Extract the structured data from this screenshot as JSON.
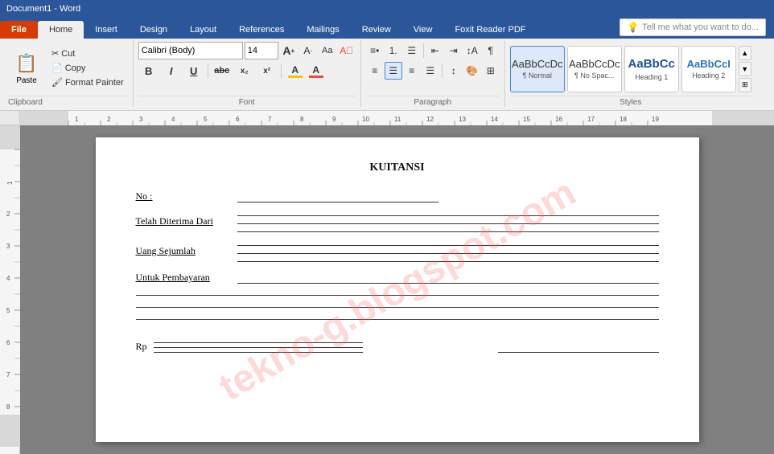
{
  "titlebar": {
    "title": "Document1 - Word"
  },
  "tabs": [
    {
      "id": "file",
      "label": "File",
      "type": "file"
    },
    {
      "id": "home",
      "label": "Home",
      "type": "active"
    },
    {
      "id": "insert",
      "label": "Insert",
      "type": "normal"
    },
    {
      "id": "design",
      "label": "Design",
      "type": "normal"
    },
    {
      "id": "layout",
      "label": "Layout",
      "type": "normal"
    },
    {
      "id": "references",
      "label": "References",
      "type": "normal"
    },
    {
      "id": "mailings",
      "label": "Mailings",
      "type": "normal"
    },
    {
      "id": "review",
      "label": "Review",
      "type": "normal"
    },
    {
      "id": "view",
      "label": "View",
      "type": "normal"
    },
    {
      "id": "foxit",
      "label": "Foxit Reader PDF",
      "type": "normal"
    }
  ],
  "toolbar": {
    "tell_me_placeholder": "Tell me what you want to do...",
    "clipboard": {
      "paste_label": "Paste",
      "cut_label": "Cut",
      "copy_label": "Copy",
      "format_painter_label": "Format Painter",
      "group_label": "Clipboard"
    },
    "font": {
      "font_name": "Calibri (Body)",
      "font_size": "14",
      "bold": "B",
      "italic": "I",
      "underline": "U",
      "strikethrough": "abc",
      "subscript": "x₂",
      "superscript": "x²",
      "grow": "A",
      "shrink": "A",
      "change_case": "Aa",
      "clear_format": "A",
      "group_label": "Font"
    },
    "paragraph": {
      "group_label": "Paragraph"
    },
    "styles": {
      "normal_label": "¶ Normal",
      "no_spacing_label": "¶ No Spac...",
      "heading1_label": "Heading 1",
      "heading2_label": "Heading 2",
      "group_label": "Styles"
    }
  },
  "document": {
    "title": "KUITANSI",
    "watermark": "tekno-g.blogspot.com",
    "fields": [
      {
        "label": "No :",
        "type": "single_line"
      },
      {
        "label": "Telah Diterima Dari",
        "type": "multi_lines"
      },
      {
        "label": "Uang Sejumlah",
        "type": "multi_lines"
      },
      {
        "label": "Untuk Pembayaran",
        "type": "single_line"
      }
    ],
    "rp_label": "Rp",
    "extra_lines": 3
  }
}
